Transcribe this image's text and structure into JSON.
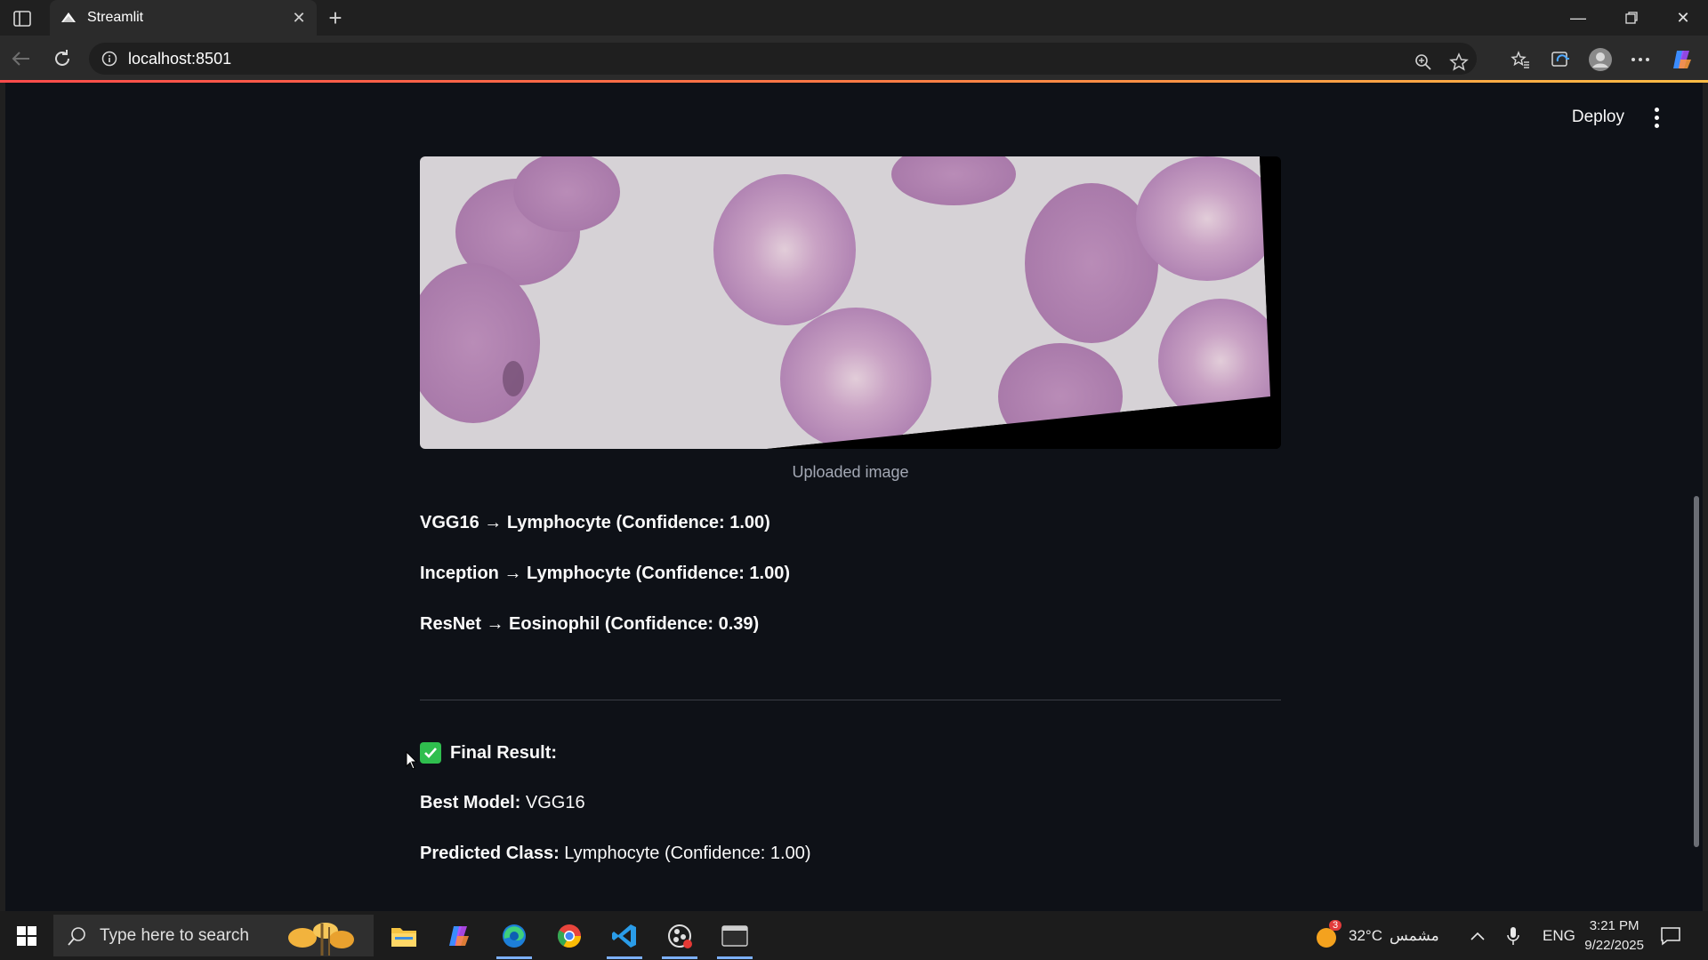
{
  "browser": {
    "tab_title": "Streamlit",
    "url": "localhost:8501"
  },
  "app": {
    "deploy_label": "Deploy",
    "image_caption": "Uploaded image",
    "results": [
      {
        "model": "VGG16",
        "arrow": "→",
        "prediction": "Lymphocyte (Confidence: 1.00)"
      },
      {
        "model": "Inception",
        "arrow": "→",
        "prediction": "Lymphocyte (Confidence: 1.00)"
      },
      {
        "model": "ResNet",
        "arrow": "→",
        "prediction": "Eosinophil (Confidence: 0.39)"
      }
    ],
    "final": {
      "heading": "Final Result:",
      "best_model_label": "Best Model:",
      "best_model_value": "VGG16",
      "predicted_class_label": "Predicted Class:",
      "predicted_class_value": "Lymphocyte (Confidence: 1.00)"
    }
  },
  "taskbar": {
    "search_placeholder": "Type here to search",
    "weather": "32°C",
    "weather_label": "مشمس",
    "weather_badge": "3",
    "language": "ENG",
    "time": "3:21 PM",
    "date": "9/22/2025"
  },
  "colors": {
    "app_bg": "#0e1117",
    "accent": "#ff4b4b",
    "check_green": "#2fbe4e"
  }
}
